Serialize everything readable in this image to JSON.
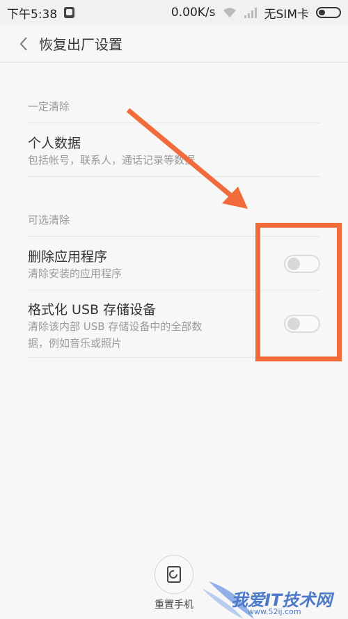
{
  "status_bar": {
    "time": "下午5:38",
    "speed": "0.00K/s",
    "sim_status": "无SIM卡"
  },
  "header": {
    "title": "恢复出厂设置"
  },
  "sections": {
    "required": {
      "label": "一定清除",
      "item_title": "个人数据",
      "item_sub": "包括帐号，联系人，通话记录等数据"
    },
    "optional": {
      "label": "可选清除",
      "items": [
        {
          "title": "删除应用程序",
          "sub": "清除安装的应用程序",
          "enabled": false
        },
        {
          "title": "格式化 USB 存储设备",
          "sub_line1": "清除该内部 USB 存储设备中的全部数",
          "sub_line2": "据，例如音乐或照片",
          "enabled": false
        }
      ]
    }
  },
  "reset": {
    "label": "重置手机"
  },
  "watermark": {
    "text": "我爱IT技术网",
    "url": "www.52ij.com"
  },
  "colors": {
    "annotation": "#f26b3a",
    "watermark": "#4d79c9"
  },
  "icons": [
    "sim-card-icon",
    "wifi-icon",
    "signal-icon",
    "battery-icon",
    "back-chevron-icon",
    "reset-phone-icon"
  ]
}
